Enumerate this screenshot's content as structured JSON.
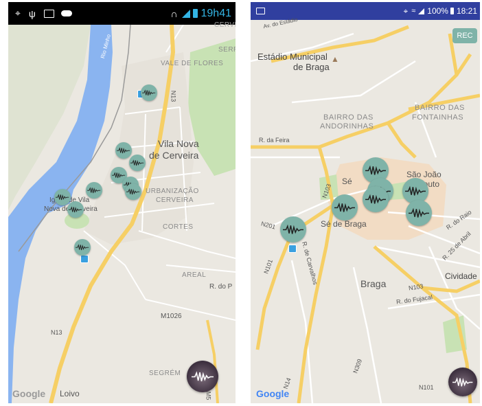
{
  "left_phone": {
    "status": {
      "time": "19h41",
      "icons": [
        "location-icon",
        "usb-icon",
        "image-icon",
        "cloud-icon",
        "headphones-icon",
        "signal-icon",
        "battery-icon"
      ]
    },
    "labels": {
      "vale_de_flores": "VALE DE FLORES",
      "serr": "SERR",
      "cerve": "CERVE",
      "vila_nova_1": "Vila Nova",
      "vila_nova_2": "de Cerveira",
      "urbanizacao_1": "URBANIZAÇÃO",
      "urbanizacao_2": "CERVEIRA",
      "cortes": "CORTES",
      "areal": "AREAL",
      "r_do_p": "R. do P",
      "igreja_1": "Igreja de Vila",
      "igreja_2": "Nova de Cerveira",
      "n13_top": "N13",
      "n13_bottom": "N13",
      "m1026": "M1026",
      "segrem": "SEGRÉM",
      "loivo": "Loivo",
      "m5": "M5",
      "rio_minho": "Rio Minho"
    },
    "google": "Google"
  },
  "right_phone": {
    "status": {
      "battery": "100%",
      "time": "18:21",
      "icons": [
        "image-icon",
        "location-icon",
        "wifi-icon",
        "signal-icon",
        "battery-icon"
      ]
    },
    "rec_label": "REC",
    "labels": {
      "av_estadio": "Av. do Estádio",
      "estadio_1": "Estádio Municipal",
      "estadio_2": "de Braga",
      "bairro_andorinhas_1": "BAIRRO DAS",
      "bairro_andorinhas_2": "ANDORINHAS",
      "bairro_fontainhas_1": "BAIRRO DAS",
      "bairro_fontainhas_2": "FONTAINHAS",
      "r_feira": "R. da Feira",
      "se": "Sé",
      "sao_joao_1": "São João",
      "sao_joao_2": "do Souto",
      "se_de_braga": "Sé de Braga",
      "n201": "N201",
      "n101_left": "N101",
      "n103_top": "N103",
      "n103_right": "N103",
      "r_raio": "R. do Raio",
      "r_25_abril": "R. 25 de Abril",
      "r_carvalhos": "R. de Carvalhos",
      "braga": "Braga",
      "cividade": "Cividade",
      "r_fujacal": "R. do Fujacal",
      "n309": "N309",
      "n14": "N14",
      "n101_bottom": "N101",
      "estadio_icon": "stadium-icon"
    },
    "google": "Google"
  },
  "colors": {
    "marker": "#7fb3a8",
    "river": "#8ab4f0",
    "major_road": "#f6cf65",
    "park": "#c8e2b4",
    "urban": "#f2dcc4",
    "status_right": "#303f9f"
  }
}
